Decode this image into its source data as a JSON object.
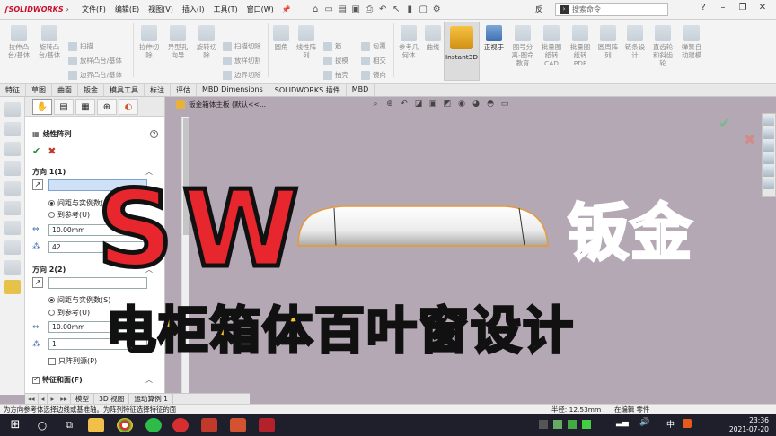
{
  "app": {
    "brand": "SOLIDWORKS"
  },
  "menu": [
    "文件(F)",
    "编辑(E)",
    "视图(V)",
    "插入(I)",
    "工具(T)",
    "窗口(W)"
  ],
  "search": {
    "placeholder": "搜索命令",
    "extra": "反"
  },
  "ribbon": {
    "big": [
      {
        "label": "拉伸凸\n台/基体"
      },
      {
        "label": "旋转凸\n台/基体"
      },
      {
        "label": "拉伸切\n除"
      },
      {
        "label": "异型孔\n向导"
      },
      {
        "label": "旋转切\n除"
      },
      {
        "label": "圆角"
      },
      {
        "label": "线性阵\n列"
      },
      {
        "label": "参考几\n何体"
      },
      {
        "label": "曲线"
      },
      {
        "label": "正视于"
      },
      {
        "label": "图号分\n离-图命\n教育"
      },
      {
        "label": "批量图\n纸转\nCAD"
      },
      {
        "label": "批量图\n纸转\nPDF"
      },
      {
        "label": "圆周阵\n列"
      },
      {
        "label": "链条设\n计"
      },
      {
        "label": "直齿轮\n和斜齿\n轮"
      },
      {
        "label": "弹簧自\n动建模"
      }
    ],
    "small": [
      "扫描",
      "放样凸台/基体",
      "边界凸台/基体",
      "扫描切除",
      "放样切割",
      "边界切除",
      "筋",
      "拔模",
      "抽壳",
      "包覆",
      "相交",
      "镜向"
    ],
    "instant3d": "Instant3D"
  },
  "tabs": [
    "特征",
    "草图",
    "曲面",
    "钣金",
    "模具工具",
    "标注",
    "评估",
    "MBD Dimensions",
    "SOLIDWORKS 插件",
    "MBD"
  ],
  "pm": {
    "title": "线性阵列",
    "dir1": {
      "header": "方向 1(1)",
      "radio1": "间距与实例数(S)",
      "radio2": "到参考(U)",
      "spacing": "10.00mm",
      "count": "42"
    },
    "dir2": {
      "header": "方向 2(2)",
      "radio1": "间距与实例数(S)",
      "radio2": "到参考(U)",
      "spacing": "10.00mm",
      "count": "1",
      "only_seed": "只阵列源(P)"
    },
    "feat": "特征和面(F)"
  },
  "btabs": [
    "模型",
    "3D 视图",
    "运动算例 1"
  ],
  "status": {
    "hint": "为方向参考体选择边线或基准轴。为阵列特征选择特征的面",
    "radius": "半径: 12.53mm",
    "state": "在编辑 零件"
  },
  "viewport": {
    "doc": "钣金箱体主板 (默认<<..."
  },
  "overlay": {
    "big": "SW",
    "right": "钣金",
    "subtitle": "电柜箱体百叶窗设计"
  },
  "clock": {
    "time": "23:36",
    "date": "2021-07-20"
  },
  "tray": {
    "ime": "中"
  },
  "colors": {
    "accent_red": "#e8262d",
    "subtitle_yellow": "#f7c52b",
    "viewport_bg": "#b4a8b4"
  }
}
